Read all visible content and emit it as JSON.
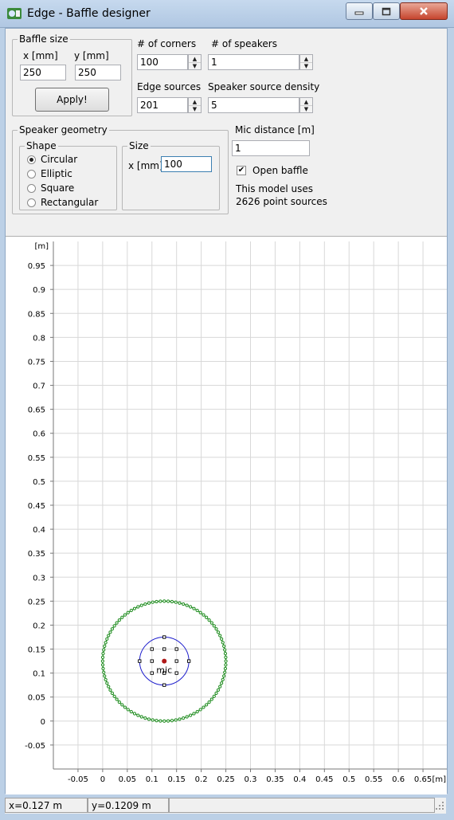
{
  "window": {
    "title": "Edge - Baffle designer"
  },
  "baffle_size": {
    "legend": "Baffle size",
    "x_label": "x [mm]",
    "x_value": "250",
    "y_label": "y [mm]",
    "y_value": "250",
    "apply_label": "Apply!"
  },
  "corners": {
    "label": "# of corners",
    "value": "100"
  },
  "speakers": {
    "label": "# of speakers",
    "value": "1"
  },
  "edge_sources": {
    "label": "Edge sources",
    "value": "201"
  },
  "source_density": {
    "label": "Speaker source density",
    "value": "5"
  },
  "speaker_geometry": {
    "legend": "Speaker geometry",
    "shape_legend": "Shape",
    "shapes": [
      {
        "label": "Circular",
        "selected": true
      },
      {
        "label": "Elliptic",
        "selected": false
      },
      {
        "label": "Square",
        "selected": false
      },
      {
        "label": "Rectangular",
        "selected": false
      }
    ],
    "size_legend": "Size",
    "size_x_label": "x [mm]",
    "size_x_value": "100"
  },
  "mic": {
    "distance_label": "Mic distance [m]",
    "distance_value": "1",
    "open_baffle_label": "Open baffle",
    "open_baffle_checked": true,
    "info_line1": "This model uses",
    "info_line2": "2626 point sources"
  },
  "chart_data": {
    "type": "scatter",
    "x_unit": "[m]",
    "y_unit": "[m]",
    "xlim": [
      -0.1,
      0.7
    ],
    "ylim": [
      -0.1,
      1.0
    ],
    "x_ticks": [
      "-0.05",
      "0",
      "0.05",
      "0.1",
      "0.15",
      "0.2",
      "0.25",
      "0.3",
      "0.35",
      "0.4",
      "0.45",
      "0.5",
      "0.55",
      "0.6",
      "0.65"
    ],
    "y_ticks": [
      "-0.05",
      "0",
      "0.05",
      "0.1",
      "0.15",
      "0.2",
      "0.25",
      "0.3",
      "0.35",
      "0.4",
      "0.45",
      "0.5",
      "0.55",
      "0.6",
      "0.65",
      "0.7",
      "0.75",
      "0.8",
      "0.85",
      "0.9",
      "0.95"
    ],
    "grid": true,
    "baffle_edge": {
      "center_x": 0.125,
      "center_y": 0.125,
      "radius": 0.125,
      "points": 100,
      "color": "#1a8a1a"
    },
    "speaker": {
      "center_x": 0.125,
      "center_y": 0.125,
      "radius": 0.05,
      "color": "#1a1acc"
    },
    "speaker_sources": [
      [
        0.125,
        0.175
      ],
      [
        0.1,
        0.15
      ],
      [
        0.125,
        0.15
      ],
      [
        0.15,
        0.15
      ],
      [
        0.075,
        0.125
      ],
      [
        0.1,
        0.125
      ],
      [
        0.125,
        0.125
      ],
      [
        0.15,
        0.125
      ],
      [
        0.175,
        0.125
      ],
      [
        0.1,
        0.1
      ],
      [
        0.125,
        0.1
      ],
      [
        0.15,
        0.1
      ],
      [
        0.125,
        0.075
      ]
    ],
    "mic_label": "mic",
    "mic_position": [
      0.125,
      0.125
    ],
    "mic_color": "#b01818"
  },
  "status": {
    "x_readout": "x=0.127 m",
    "y_readout": "y=0.1209 m"
  }
}
